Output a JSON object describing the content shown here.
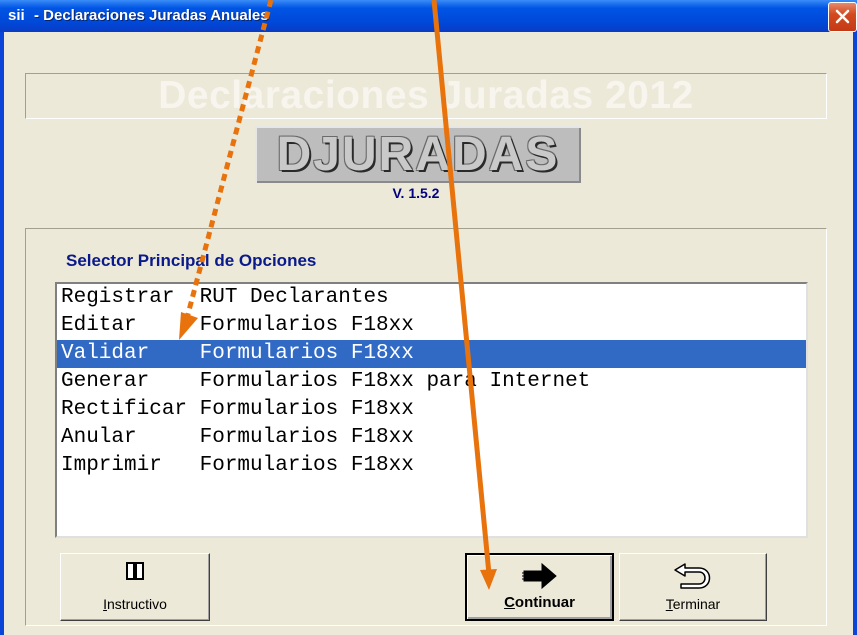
{
  "window": {
    "title": "- Declaraciones Juradas Anuales",
    "icon_text": "sii"
  },
  "header": {
    "banner": "Declaraciones Juradas 2012",
    "logo": "DJURADAS",
    "version": "V. 1.5.2"
  },
  "selector": {
    "label": "Selector Principal de Opciones",
    "items": [
      {
        "text": "Registrar  RUT Declarantes",
        "selected": false
      },
      {
        "text": "Editar     Formularios F18xx",
        "selected": false
      },
      {
        "text": "Validar    Formularios F18xx",
        "selected": true
      },
      {
        "text": "Generar    Formularios F18xx para Internet",
        "selected": false
      },
      {
        "text": "Rectificar Formularios F18xx",
        "selected": false
      },
      {
        "text": "Anular     Formularios F18xx",
        "selected": false
      },
      {
        "text": "Imprimir   Formularios F18xx",
        "selected": false
      }
    ]
  },
  "buttons": {
    "instructivo": {
      "label": "Instructivo",
      "icon": "book-icon"
    },
    "continuar": {
      "label": "Continuar",
      "icon": "right-arrow-icon"
    },
    "terminar": {
      "label": "Terminar",
      "icon": "u-turn-arrow-icon"
    }
  },
  "annotations": {
    "arrow_color": "#e8720c"
  },
  "colors": {
    "titlebar": "#0055e5",
    "selection": "#316ac5",
    "label": "#0a1a8a"
  }
}
